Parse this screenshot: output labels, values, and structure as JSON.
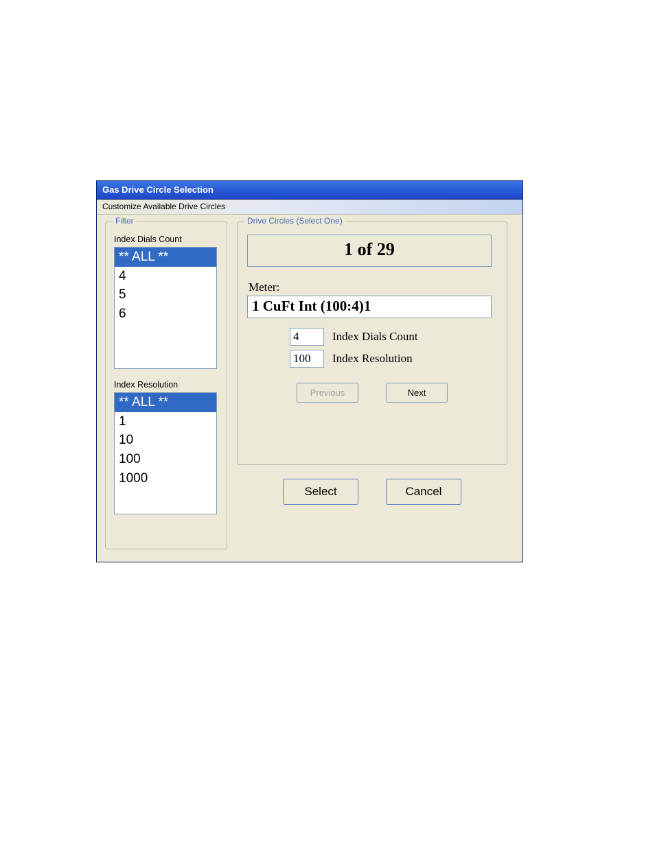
{
  "dialog": {
    "title": "Gas Drive Circle Selection",
    "menu": "Customize Available Drive Circles"
  },
  "filter": {
    "legend": "Filter",
    "dials_label": "Index Dials Count",
    "dials_items": [
      "** ALL **",
      "4",
      "5",
      "6"
    ],
    "dials_selected_index": 0,
    "res_label": "Index Resolution",
    "res_items": [
      "** ALL **",
      "1",
      "10",
      "100",
      "1000"
    ],
    "res_selected_index": 0
  },
  "drive": {
    "legend": "Drive Circles (Select One)",
    "counter": "1 of 29",
    "meter_label": "Meter:",
    "meter_value": "1 CuFt Int (100:4)1",
    "dials_value": "4",
    "dials_label": "Index Dials Count",
    "res_value": "100",
    "res_label": "Index Resolution",
    "prev": "Previous",
    "next": "Next",
    "prev_enabled": false,
    "next_enabled": true
  },
  "actions": {
    "select": "Select",
    "cancel": "Cancel"
  }
}
